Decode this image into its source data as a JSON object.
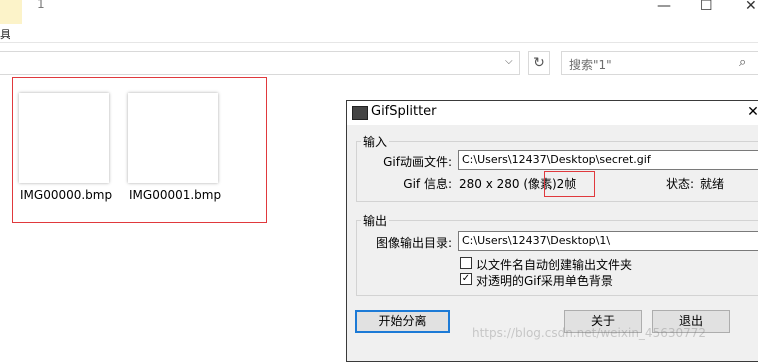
{
  "explorer": {
    "tab_number": "1",
    "ribbon_fragment": "具",
    "search_placeholder": "搜索\"1\"",
    "window_controls": {
      "minimize": "—",
      "maximize": "☐",
      "close": "✕"
    },
    "files": [
      {
        "name": "IMG00000.bmp"
      },
      {
        "name": "IMG00001.bmp"
      }
    ],
    "colors": {
      "highlight_frame": "#e0393d"
    }
  },
  "dialog": {
    "title": "GifSplitter",
    "input_group": "输入",
    "gif_file_label": "Gif动画文件:",
    "gif_file_value": "C:\\Users\\12437\\Desktop\\secret.gif",
    "gif_info_label": "Gif 信息:",
    "gif_info_size": "280 x 280 (像素)",
    "gif_info_frames": ", 2帧",
    "status_label": "状态:",
    "status_value": "就绪",
    "output_group": "输出",
    "output_dir_label": "图像输出目录:",
    "output_dir_value": "C:\\Users\\12437\\Desktop\\1\\",
    "option_auto_folder": "以文件名自动创建输出文件夹",
    "option_auto_folder_checked": false,
    "option_single_bg": "对透明的Gif采用单色背景",
    "option_single_bg_checked": true,
    "btn_start": "开始分离",
    "btn_about": "关于",
    "btn_exit": "退出"
  },
  "watermark": "https://blog.csdn.net/weixin_45630772"
}
